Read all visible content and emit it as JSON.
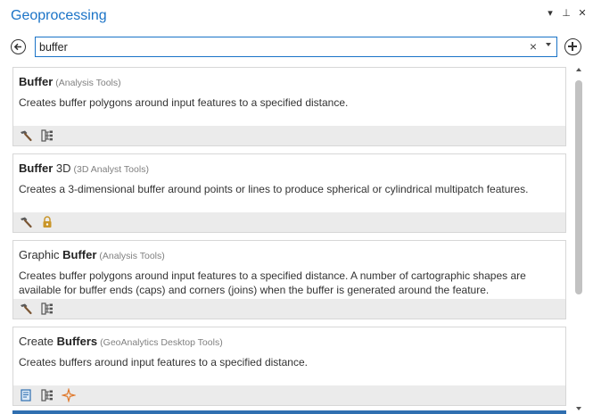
{
  "pane": {
    "title": "Geoprocessing",
    "controls": [
      "▾",
      "⊥",
      "✕"
    ]
  },
  "search": {
    "value": "buffer",
    "clear_glyph": "×"
  },
  "results": [
    {
      "pre": "",
      "bold": "Buffer",
      "post": "",
      "category": "(Analysis Tools)",
      "description": "Creates buffer polygons around input features to a specified distance.",
      "icons": [
        "hammer-icon",
        "model-tree-icon"
      ]
    },
    {
      "pre": "",
      "bold": "Buffer",
      "post": " 3D",
      "category": "(3D Analyst Tools)",
      "description": "Creates a 3-dimensional buffer around points or lines to produce spherical or cylindrical multipatch features.",
      "icons": [
        "hammer-icon",
        "lock-icon"
      ]
    },
    {
      "pre": "Graphic ",
      "bold": "Buffer",
      "post": "",
      "category": "(Analysis Tools)",
      "description": "Creates buffer polygons around input features to a specified distance. A number of cartographic shapes are available for buffer ends (caps) and corners (joins) when the buffer is generated around the feature.",
      "icons": [
        "hammer-icon",
        "model-tree-icon"
      ]
    },
    {
      "pre": "Create ",
      "bold": "Buffers",
      "post": "",
      "category": "(GeoAnalytics Desktop Tools)",
      "description": "Creates buffers around input features to a specified distance.",
      "icons": [
        "script-icon",
        "model-tree-icon",
        "sparkle-icon"
      ]
    }
  ],
  "colors": {
    "title": "#1a73c7",
    "search_border": "#1a73c7",
    "card_footer": "#ebebeb",
    "lock": "#c9962a",
    "sparkle": "#e0782a"
  }
}
